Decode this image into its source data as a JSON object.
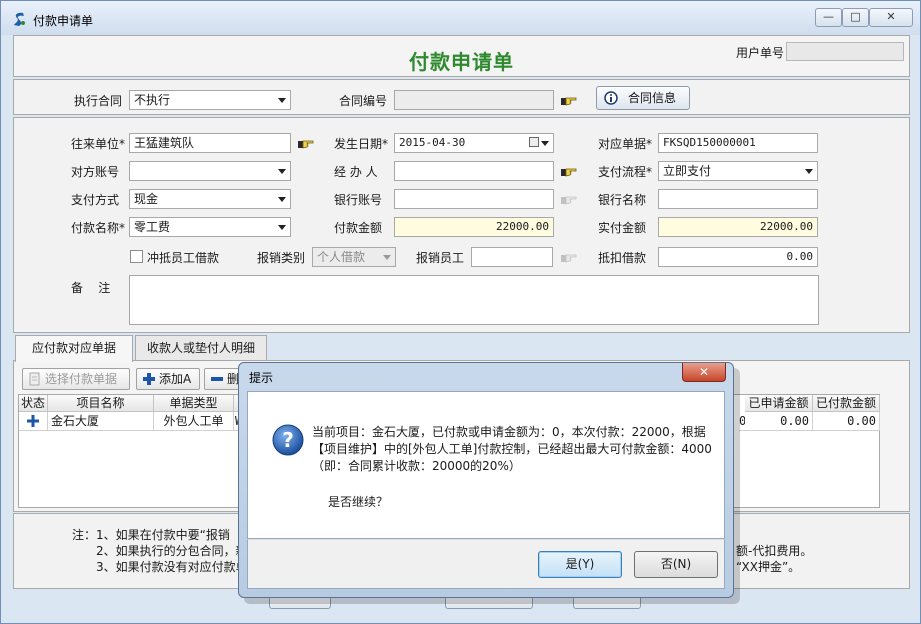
{
  "window": {
    "title": "付款申请单",
    "controls": {
      "minimize": "—",
      "maximize": "□",
      "close": "✕"
    }
  },
  "form": {
    "heading": "付款申请单",
    "user_no_label": "用户单号",
    "user_no_value": ""
  },
  "contract": {
    "exec_label": "执行合同",
    "exec_value": "不执行",
    "contract_no_label": "合同编号",
    "contract_no_value": "",
    "info_button": "合同信息"
  },
  "fields": {
    "partner_label": "往来单位",
    "partner_value": "王猛建筑队",
    "date_label": "发生日期",
    "date_value": "2015-04-30",
    "bill_label": "对应单据",
    "bill_value": "FKSQD150000001",
    "acct_label": "对方账号",
    "acct_value": "",
    "handler_label": "经 办 人",
    "handler_value": "",
    "flow_label": "支付流程",
    "flow_value": "立即支付",
    "paymethod_label": "支付方式",
    "paymethod_value": "现金",
    "bankacct_label": "银行账号",
    "bankacct_value": "",
    "bankname_label": "银行名称",
    "bankname_value": "",
    "payname_label": "付款名称",
    "payname_value": "零工费",
    "amount_label": "付款金额",
    "amount_value": "22000.00",
    "actual_label": "实付金额",
    "actual_value": "22000.00",
    "offset_label": "冲抵员工借款",
    "reimb_type_label": "报销类别",
    "reimb_type_value": "个人借款",
    "reimb_emp_label": "报销员工",
    "reimb_emp_value": "",
    "deduct_label": "抵扣借款",
    "deduct_value": "0.00",
    "remark_label": "备    注",
    "remark_value": "",
    "required_mark": "*"
  },
  "tabs": [
    {
      "label": "应付款对应单据"
    },
    {
      "label": "收款人或垫付人明细"
    }
  ],
  "toolbar": {
    "select_bill": "选择付款单据",
    "add": "添加A",
    "remove": "删"
  },
  "grid": {
    "headers": [
      "状态",
      "项目名称",
      "单据类型",
      "已申请金额",
      "已付款金额"
    ],
    "rows": [
      {
        "project": "金石大厦",
        "type": "外包人工单",
        "applied": "0.00",
        "paid": "0.00"
      }
    ],
    "partial_cells": [
      "W",
      "0"
    ]
  },
  "notes": {
    "line1": "注：1、如果在付款中要“报销",
    "line2": "2、如果执行的分包合同，新",
    "line3": "3、如果付款没有对应付款单",
    "line2_tail": "额-代扣费用。",
    "line3_tail": "“XX押金”。"
  },
  "dialog": {
    "title": "提示",
    "message": "当前项目：金石大厦，已付款或申请金额为：0，本次付款：22000，根据【项目维护】中的[外包人工单]付款控制，已经超出最大可付款金额：4000（即：合同累计收款：20000的20%）",
    "question": "是否继续？",
    "yes": "是(Y)",
    "no": "否(N)",
    "close": "✕"
  },
  "colors": {
    "title_green": "#2f8a2f",
    "highlight_yellow": "#fffce0",
    "window_frame": "#dbe6f3"
  }
}
